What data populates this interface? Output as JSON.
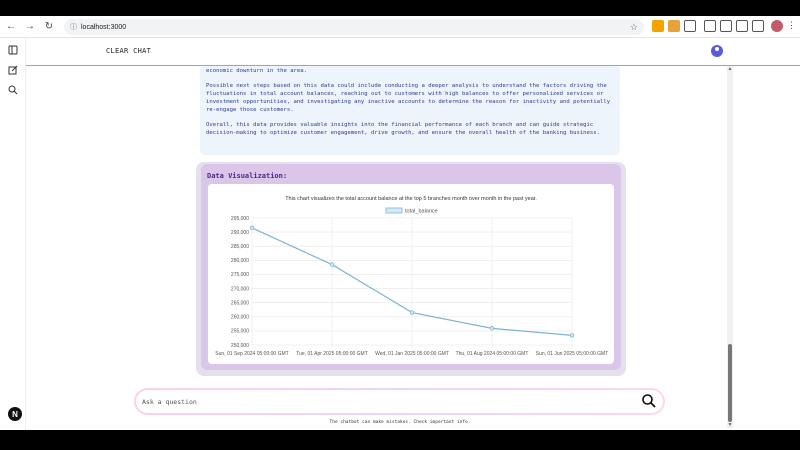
{
  "browser": {
    "url": "localhost:3000"
  },
  "header": {
    "title": "CLEAR CHAT"
  },
  "message": {
    "paragraphs": [
      "economic downturn in the area.",
      "Possible next steps based on this data could include conducting a deeper analysis to understand the factors driving the fluctuations in total account balances, reaching out to customers with high balances to offer personalized services or investment opportunities, and investigating any inactive accounts to determine the reason for inactivity and potentially re-engage those customers.",
      "Overall, this data provides valuable insights into the financial performance of each branch and can guide strategic decision-making to optimize customer engagement, drive growth, and ensure the overall health of the banking business."
    ]
  },
  "visualization": {
    "label": "Data Visualization:"
  },
  "chart_data": {
    "type": "line",
    "title": "This chart visualizes the total account balance at the top 5 branches month over month in the past year.",
    "categories": [
      "Sun, 01 Sep 2024 05:00:00 GMT",
      "Tue, 01 Apr 2025 05:00:00 GMT",
      "Wed, 01 Jan 2025 05:00:00 GMT",
      "Thu, 01 Aug 2024 05:00:00 GMT",
      "Sun, 01 Jun 2025 05:00:00 GMT"
    ],
    "series": [
      {
        "name": "total_balance",
        "values": [
          291500,
          278500,
          261500,
          255900,
          253400
        ]
      }
    ],
    "ylim": [
      250000,
      295000
    ],
    "yticks": [
      "250,000",
      "255,000",
      "260,000",
      "265,000",
      "270,000",
      "275,000",
      "280,000",
      "285,000",
      "290,000",
      "295,000"
    ],
    "ytick_values": [
      250000,
      255000,
      260000,
      265000,
      270000,
      275000,
      280000,
      285000,
      290000,
      295000
    ],
    "grid": true,
    "legend": "top-center",
    "colors": {
      "line": "#7fb3d5",
      "fill": "#d6e8f5"
    }
  },
  "input": {
    "placeholder": "Ask a question"
  },
  "footer": {
    "disclaimer": "The chatbot can make mistakes. Check important info."
  },
  "app_badge": "N"
}
